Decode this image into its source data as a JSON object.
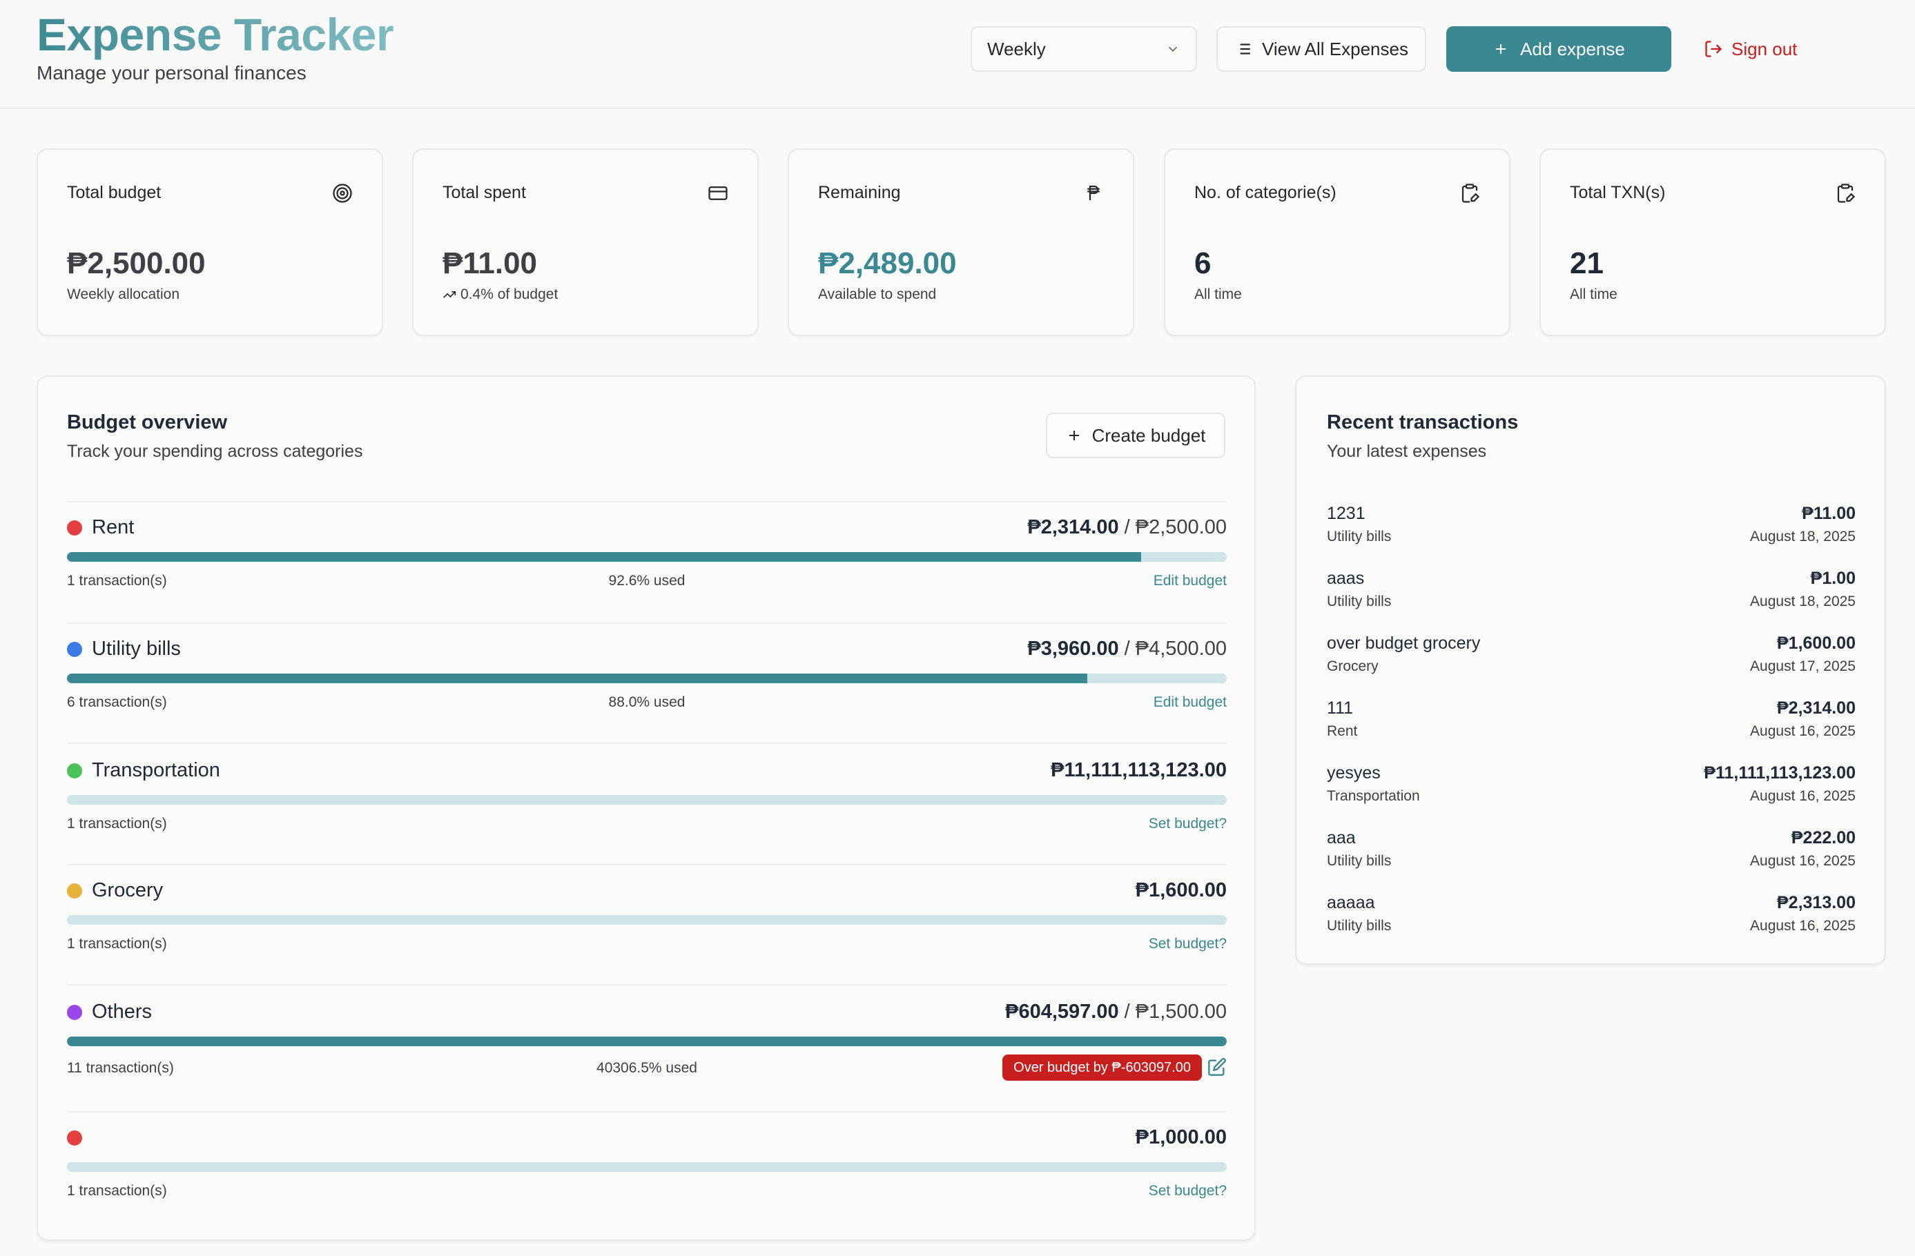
{
  "header": {
    "title": "Expense Tracker",
    "subtitle": "Manage your personal finances",
    "period_select": "Weekly",
    "view_all_label": "View All Expenses",
    "add_expense_label": "Add expense",
    "sign_out_label": "Sign out"
  },
  "stats": [
    {
      "label": "Total budget",
      "icon": "target-icon",
      "value": "₱2,500.00",
      "note": "Weekly allocation"
    },
    {
      "label": "Total spent",
      "icon": "credit-card-icon",
      "value": "₱11.00",
      "note": "0.4% of budget"
    },
    {
      "label": "Remaining",
      "icon": "peso-icon",
      "value": "₱2,489.00",
      "note": "Available to spend"
    },
    {
      "label": "No. of categorie(s)",
      "icon": "clipboard-edit-icon",
      "value": "6",
      "note": "All time"
    },
    {
      "label": "Total TXN(s)",
      "icon": "clipboard-edit-icon",
      "value": "21",
      "note": "All time"
    }
  ],
  "budget_overview": {
    "title": "Budget overview",
    "subtitle": "Track your spending across categories",
    "create_label": "Create budget",
    "categories": [
      {
        "name": "Rent",
        "color": "#e53e3e",
        "spent": "₱2,314.00",
        "budget": "₱2,500.00",
        "progress": 0.926,
        "transactions": "1 transaction(s)",
        "used": "92.6% used",
        "link": "Edit budget"
      },
      {
        "name": "Utility bills",
        "color": "#3b7be8",
        "spent": "₱3,960.00",
        "budget": "₱4,500.00",
        "progress": 0.88,
        "transactions": "6 transaction(s)",
        "used": "88.0% used",
        "link": "Edit budget"
      },
      {
        "name": "Transportation",
        "color": "#4bc15a",
        "spent": "₱11,111,113,123.00",
        "budget": "",
        "progress": 0,
        "transactions": "1 transaction(s)",
        "used": "",
        "link": "Set budget?"
      },
      {
        "name": "Grocery",
        "color": "#e6b23a",
        "spent": "₱1,600.00",
        "budget": "",
        "progress": 0,
        "transactions": "1 transaction(s)",
        "used": "",
        "link": "Set budget?"
      },
      {
        "name": "Others",
        "color": "#9b46e8",
        "spent": "₱604,597.00",
        "budget": "₱1,500.00",
        "progress": 1.0,
        "transactions": "11 transaction(s)",
        "used": "40306.5% used",
        "badge": "Over budget by ₱-603097.00"
      },
      {
        "name": "",
        "color": "#e53e3e",
        "spent": "₱1,000.00",
        "budget": "",
        "progress": 0,
        "transactions": "1 transaction(s)",
        "used": "",
        "link": "Set budget?"
      }
    ]
  },
  "recent": {
    "title": "Recent transactions",
    "subtitle": "Your latest expenses",
    "items": [
      {
        "name": "1231",
        "category": "Utility bills",
        "amount": "₱11.00",
        "date": "August 18, 2025"
      },
      {
        "name": "aaas",
        "category": "Utility bills",
        "amount": "₱1.00",
        "date": "August 18, 2025"
      },
      {
        "name": "over budget grocery",
        "category": "Grocery",
        "amount": "₱1,600.00",
        "date": "August 17, 2025"
      },
      {
        "name": "111",
        "category": "Rent",
        "amount": "₱2,314.00",
        "date": "August 16, 2025"
      },
      {
        "name": "yesyes",
        "category": "Transportation",
        "amount": "₱11,111,113,123.00",
        "date": "August 16, 2025"
      },
      {
        "name": "aaa",
        "category": "Utility bills",
        "amount": "₱222.00",
        "date": "August 16, 2025"
      },
      {
        "name": "aaaaa",
        "category": "Utility bills",
        "amount": "₱2,313.00",
        "date": "August 16, 2025"
      }
    ]
  }
}
